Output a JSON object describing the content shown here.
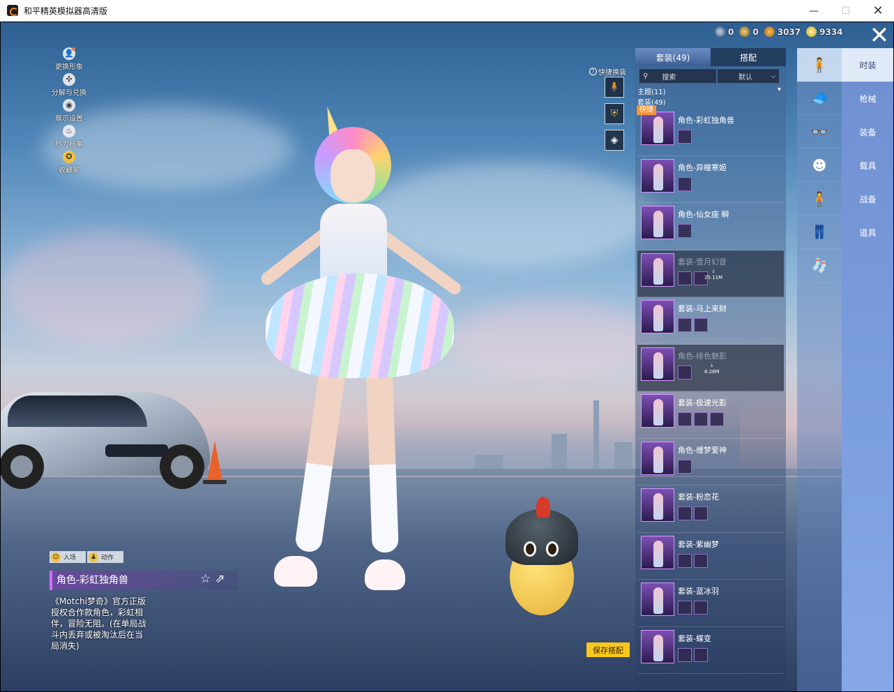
{
  "window": {
    "title": "和平精英模拟器高清版",
    "controls": {
      "minimize": "—",
      "maximize": "☐",
      "close": "✕"
    }
  },
  "topbar": {
    "currencies": [
      {
        "icon": "coin-gray-icon",
        "value": "0"
      },
      {
        "icon": "coin-gold-icon",
        "value": "0"
      },
      {
        "icon": "coin-orange-icon",
        "value": "3037"
      },
      {
        "icon": "coin-yellow-icon",
        "value": "9334"
      }
    ],
    "close_label": "✕"
  },
  "left_menu": [
    {
      "label": "更换形象",
      "icon": "avatar-icon",
      "glyph": "👤"
    },
    {
      "label": "分解与兑换",
      "icon": "puzzle-icon",
      "glyph": "✣"
    },
    {
      "label": "展示设置",
      "icon": "eye-icon",
      "glyph": "◉"
    },
    {
      "label": "热力档案",
      "icon": "flame-icon",
      "glyph": "♨"
    },
    {
      "label": "收藏家",
      "icon": "collector-badge-icon",
      "glyph": "✪"
    }
  ],
  "quick_change": {
    "label": "快捷换装",
    "help": "?",
    "slots": [
      {
        "icon": "figure-icon",
        "glyph": "🧍"
      },
      {
        "icon": "emblem-icon",
        "glyph": "⛨"
      },
      {
        "icon": "diamond-icon",
        "glyph": "◈"
      }
    ]
  },
  "action_tabs": [
    {
      "label": "入场",
      "glyph": "☺"
    },
    {
      "label": "动作",
      "glyph": "♟"
    }
  ],
  "selected_item": {
    "title": "角色-彩虹独角兽",
    "favorite_glyph": "☆",
    "share_glyph": "⇗",
    "description": "《Motchi梦奇》官方正版授权合作款角色，彩虹相伴，冒险无阻。(在单局战斗内丢弃或被淘汰后在当局消失)"
  },
  "save_button": "保存搭配",
  "panel": {
    "tabs": [
      {
        "label": "套装(49)",
        "active": true
      },
      {
        "label": "搭配",
        "active": false
      }
    ],
    "search_placeholder": "搜索",
    "sort_label": "默认",
    "theme_group": "主题(11)",
    "set_group": "套装(49)",
    "quick_badge": "快捷",
    "items": [
      {
        "name": "角色-彩虹独角兽",
        "parts": 1,
        "dim": false,
        "download": ""
      },
      {
        "name": "角色-异瞳寒姬",
        "parts": 1,
        "dim": false,
        "download": ""
      },
      {
        "name": "角色-仙女座 瞬",
        "parts": 1,
        "dim": false,
        "download": ""
      },
      {
        "name": "套装-雪月幻音",
        "parts": 2,
        "dim": true,
        "download": "25.11M"
      },
      {
        "name": "套装-马上来财",
        "parts": 2,
        "dim": false,
        "download": ""
      },
      {
        "name": "角色-绯色魅影",
        "parts": 1,
        "dim": true,
        "download": "8.28M"
      },
      {
        "name": "套装-极速光影",
        "parts": 3,
        "dim": false,
        "download": ""
      },
      {
        "name": "角色-缠梦爱神",
        "parts": 1,
        "dim": false,
        "download": ""
      },
      {
        "name": "套装-粉恋花",
        "parts": 2,
        "dim": false,
        "download": ""
      },
      {
        "name": "套装-紫幽梦",
        "parts": 2,
        "dim": false,
        "download": ""
      },
      {
        "name": "套装-蓝冰羽",
        "parts": 2,
        "dim": false,
        "download": ""
      },
      {
        "name": "套装-蝶变",
        "parts": 2,
        "dim": false,
        "download": ""
      }
    ]
  },
  "category_icons": [
    {
      "icon": "outfit-figure-icon",
      "glyph": "🧍",
      "active": true
    },
    {
      "icon": "cap-icon",
      "glyph": "🧢",
      "active": false
    },
    {
      "icon": "glasses-icon",
      "glyph": "👓",
      "active": false
    },
    {
      "icon": "face-icon",
      "glyph": "☻",
      "active": false
    },
    {
      "icon": "body-figure-icon",
      "glyph": "🧍",
      "active": false
    },
    {
      "icon": "pants-icon",
      "glyph": "👖",
      "active": false
    },
    {
      "icon": "socks-icon",
      "glyph": "🧦",
      "active": false
    }
  ],
  "main_tabs": [
    {
      "label": "时装",
      "active": true
    },
    {
      "label": "枪械",
      "active": false
    },
    {
      "label": "装备",
      "active": false
    },
    {
      "label": "载具",
      "active": false
    },
    {
      "label": "战备",
      "active": false
    },
    {
      "label": "道具",
      "active": false
    }
  ]
}
